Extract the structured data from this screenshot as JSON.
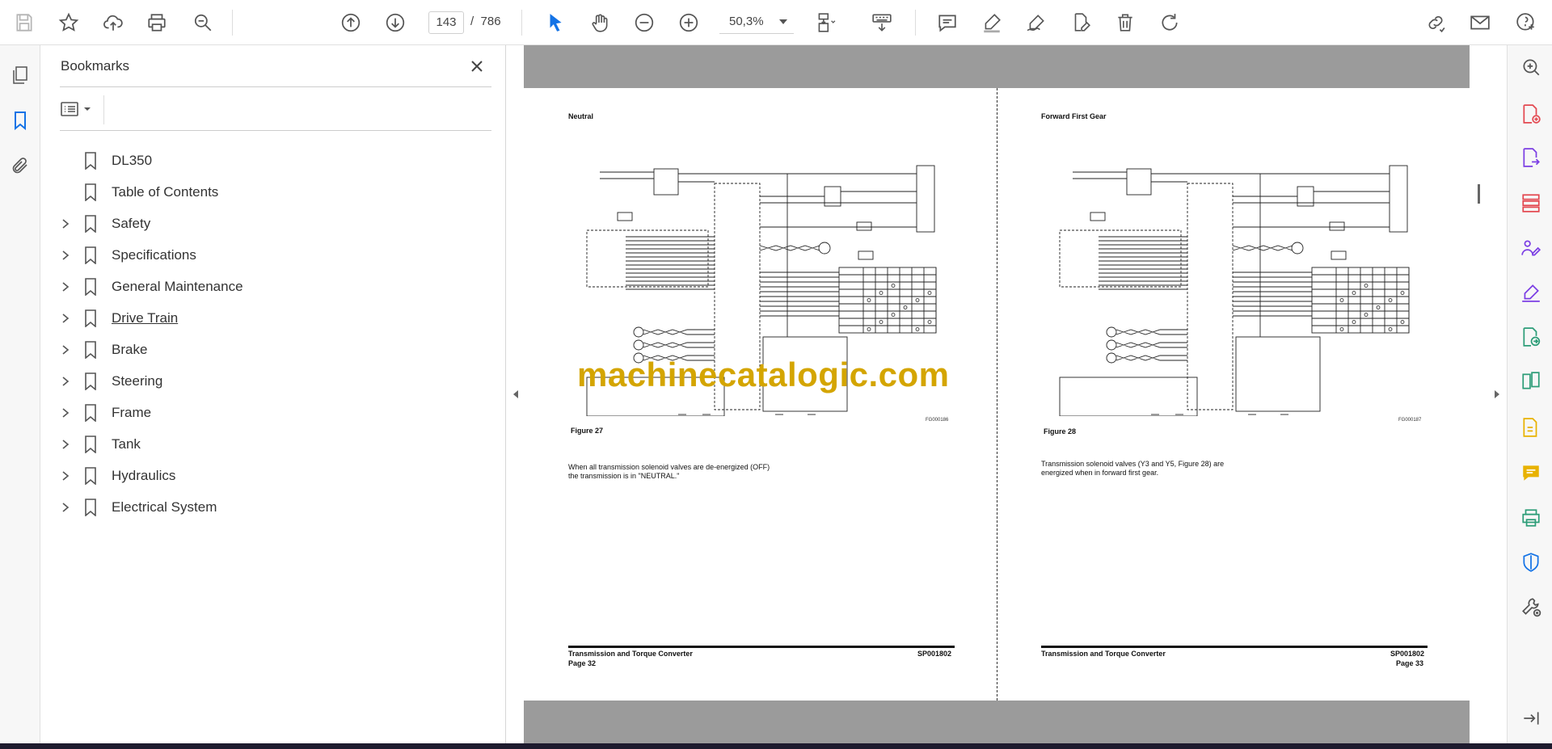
{
  "toolbar": {
    "page_current": "143",
    "page_total": "786",
    "page_separator": "/",
    "zoom": "50,3%"
  },
  "bookmarks_panel": {
    "title": "Bookmarks",
    "items": [
      {
        "label": "DL350",
        "expandable": false
      },
      {
        "label": "Table of Contents",
        "expandable": false
      },
      {
        "label": "Safety",
        "expandable": true
      },
      {
        "label": "Specifications",
        "expandable": true
      },
      {
        "label": "General Maintenance",
        "expandable": true
      },
      {
        "label": "Drive Train",
        "expandable": true,
        "hovered": true
      },
      {
        "label": "Brake",
        "expandable": true
      },
      {
        "label": "Steering",
        "expandable": true
      },
      {
        "label": "Frame",
        "expandable": true
      },
      {
        "label": "Tank",
        "expandable": true
      },
      {
        "label": "Hydraulics",
        "expandable": true
      },
      {
        "label": "Electrical System",
        "expandable": true
      }
    ]
  },
  "document": {
    "left_page": {
      "heading": "Neutral",
      "figure_caption": "Figure 27",
      "figure_id": "FG000186",
      "body_line1": "When all transmission solenoid valves are de-energized (OFF)",
      "body_line2": "the transmission is in \"NEUTRAL.\"",
      "footer_title": "Transmission and Torque Converter",
      "footer_code": "SP001802",
      "footer_page": "Page 32"
    },
    "right_page": {
      "heading": "Forward First Gear",
      "figure_caption": "Figure 28",
      "figure_id": "FG000187",
      "body_line1": "Transmission solenoid valves (Y3 and Y5, Figure 28) are",
      "body_line2": "energized when in forward first gear.",
      "footer_title": "Transmission and Torque Converter",
      "footer_code": "SP001802",
      "footer_page": "Page 33"
    },
    "watermark": "machinecatalogic.com"
  },
  "colors": {
    "accent": "#1473e6",
    "tool_pink": "#e34850",
    "tool_purple": "#7c3fe4",
    "tool_green": "#2d9d78",
    "tool_yellow": "#e8b200",
    "tool_blue": "#1473e6",
    "watermark": "#d4a500"
  }
}
